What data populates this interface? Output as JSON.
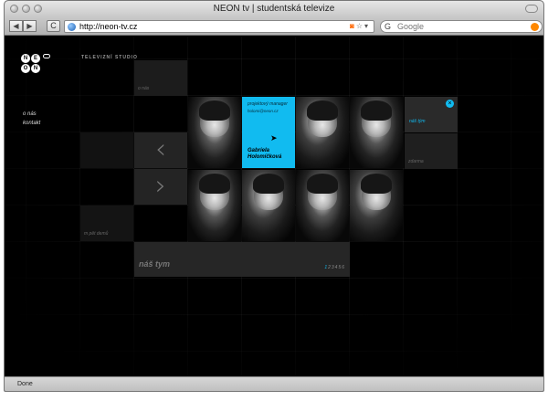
{
  "window": {
    "title": "NEON tv | studentská televize"
  },
  "toolbar": {
    "back": "◀",
    "forward": "▶",
    "reload": "C",
    "url": "http://neon-tv.cz",
    "search_placeholder": "Google",
    "search_engine_icon": "G"
  },
  "site": {
    "logo_letters": [
      "N",
      "E",
      "O",
      "N"
    ],
    "studio_label": "TELEVIZNÍ STUDIO",
    "nav": [
      "o nás",
      "kontakt"
    ],
    "cell_labels": {
      "about": "o nás",
      "student_tv": "m pět demů",
      "partners": "zdarma"
    },
    "profile": {
      "role": "projektový manager",
      "email": "holomi@neon.cz",
      "name": "Gabriela Holomíčková"
    },
    "panel_label": "náš tým",
    "team_label": "náš tym",
    "pager": [
      "1",
      "2",
      "3",
      "4",
      "5",
      "6"
    ],
    "pager_current": "1",
    "accent": "#11bbf0"
  },
  "status": {
    "text": "Done"
  }
}
